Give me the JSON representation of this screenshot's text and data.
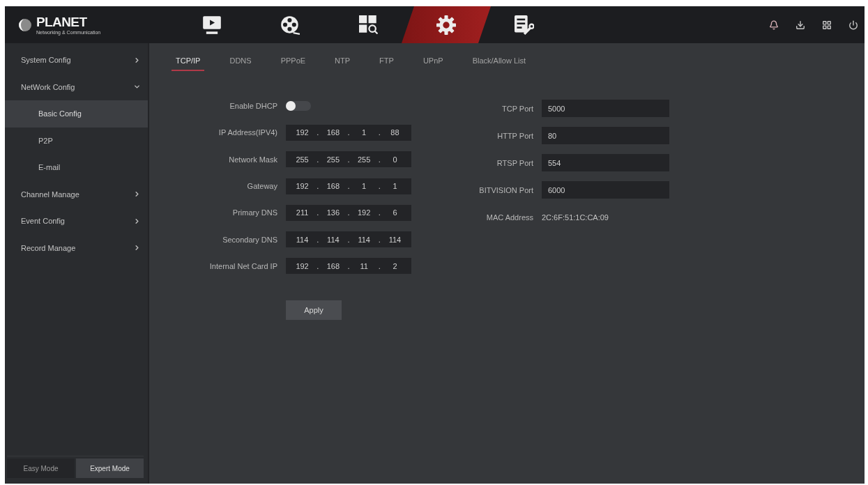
{
  "logo": {
    "name": "PLANET",
    "tagline": "Networking & Communication"
  },
  "nav_tabs": [
    {
      "kind": "play",
      "selected": false
    },
    {
      "kind": "reel",
      "selected": false
    },
    {
      "kind": "search",
      "selected": false
    },
    {
      "kind": "gear",
      "selected": true
    },
    {
      "kind": "tools",
      "selected": false
    }
  ],
  "sidebar": {
    "items": [
      {
        "label": "System Config",
        "expanded": false
      },
      {
        "label": "NetWork Config",
        "expanded": true,
        "children": [
          {
            "label": "Basic Config",
            "selected": true
          },
          {
            "label": "P2P",
            "selected": false
          },
          {
            "label": "E-mail",
            "selected": false
          }
        ]
      },
      {
        "label": "Channel Manage",
        "expanded": false
      },
      {
        "label": "Event Config",
        "expanded": false
      },
      {
        "label": "Record Manage",
        "expanded": false
      }
    ],
    "modes": [
      {
        "label": "Easy Mode",
        "selected": false
      },
      {
        "label": "Expert Mode",
        "selected": true
      }
    ]
  },
  "tabs": [
    {
      "label": "TCP/IP",
      "selected": true
    },
    {
      "label": "DDNS",
      "selected": false
    },
    {
      "label": "PPPoE",
      "selected": false
    },
    {
      "label": "NTP",
      "selected": false
    },
    {
      "label": "FTP",
      "selected": false
    },
    {
      "label": "UPnP",
      "selected": false
    },
    {
      "label": "Black/Allow List",
      "selected": false
    }
  ],
  "network": {
    "dhcp": {
      "label": "Enable DHCP",
      "on": false
    },
    "addresses": [
      {
        "label": "IP Address(IPV4)",
        "value": "192 . 168 . 1 . 88"
      },
      {
        "label": "Network Mask",
        "value": "255 . 255 . 255 . 0"
      },
      {
        "label": "Gateway",
        "value": "192 . 168 . 1 . 1"
      },
      {
        "label": "Primary DNS",
        "value": "211 . 136 . 192 . 6"
      },
      {
        "label": "Secondary DNS",
        "value": "114 . 114 . 114 . 114"
      },
      {
        "label": "Internal Net Card IP",
        "value": "192 . 168 . 11 . 2"
      }
    ],
    "apply": "Apply"
  },
  "ports": {
    "fields": [
      {
        "label": "TCP Port",
        "value": "5000"
      },
      {
        "label": "HTTP Port",
        "value": "80"
      },
      {
        "label": "RTSP Port",
        "value": "554"
      },
      {
        "label": "BITVISION Port",
        "value": "6000"
      }
    ],
    "mac": {
      "label": "MAC Address",
      "value": "2C:6F:51:1C:CA:09"
    }
  }
}
